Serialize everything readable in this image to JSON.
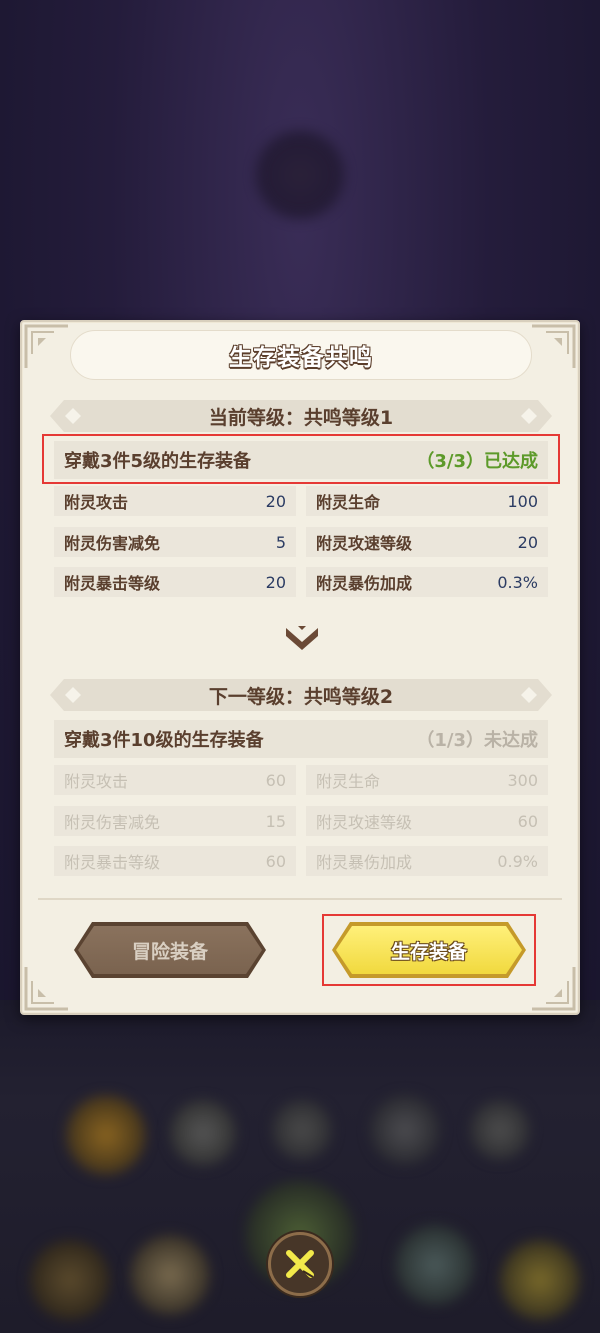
{
  "panel": {
    "title": "生存装备共鸣"
  },
  "current_level": {
    "header": "当前等级：共鸣等级1",
    "requirement": "穿戴3件5级的生存装备",
    "progress": "（3/3）已达成",
    "stats": [
      {
        "label": "附灵攻击",
        "value": "20"
      },
      {
        "label": "附灵生命",
        "value": "100"
      },
      {
        "label": "附灵伤害减免",
        "value": "5"
      },
      {
        "label": "附灵攻速等级",
        "value": "20"
      },
      {
        "label": "附灵暴击等级",
        "value": "20"
      },
      {
        "label": "附灵暴伤加成",
        "value": "0.3%"
      }
    ]
  },
  "next_level": {
    "header": "下一等级：共鸣等级2",
    "requirement": "穿戴3件10级的生存装备",
    "progress": "（1/3）未达成",
    "stats": [
      {
        "label": "附灵攻击",
        "value": "60"
      },
      {
        "label": "附灵生命",
        "value": "300"
      },
      {
        "label": "附灵伤害减免",
        "value": "15"
      },
      {
        "label": "附灵攻速等级",
        "value": "60"
      },
      {
        "label": "附灵暴击等级",
        "value": "60"
      },
      {
        "label": "附灵暴伤加成",
        "value": "0.9%"
      }
    ]
  },
  "buttons": {
    "adventure": "冒险装备",
    "survival": "生存装备"
  },
  "colors": {
    "panel_bg": "#f3efe3",
    "achieved_green": "#5d9a2a",
    "highlight_red": "#e53935",
    "stat_value": "#2c3c63"
  }
}
